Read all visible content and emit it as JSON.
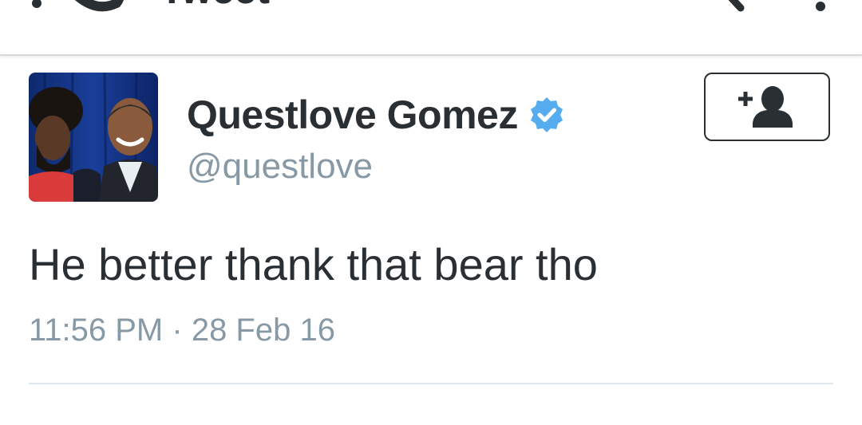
{
  "appbar": {
    "title": "Tweet",
    "back_icon": "back-arrow-icon",
    "search_icon": "search-icon",
    "overflow_icon": "overflow-menu-icon"
  },
  "tweet": {
    "author": {
      "display_name": "Questlove Gomez",
      "handle": "@questlove",
      "verified": true,
      "avatar_icon": "avatar"
    },
    "follow_icon": "add-user-icon",
    "text": "He better thank that bear tho",
    "time": "11:56 PM",
    "separator": "·",
    "date": "28 Feb 16"
  },
  "colors": {
    "text_primary": "#292f33",
    "text_secondary": "#8899a6",
    "verified_blue": "#55acee",
    "divider": "#e1e8ed"
  }
}
